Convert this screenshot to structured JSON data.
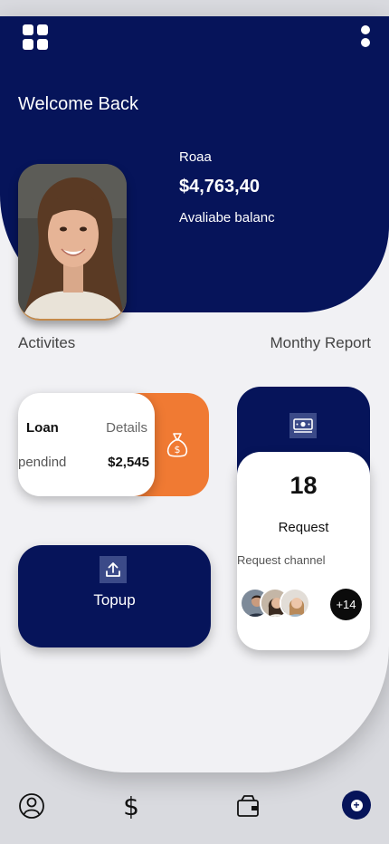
{
  "header": {
    "welcome": "Welcome Back",
    "user_name": "Roaa",
    "balance": "$4,763,40",
    "balance_label": "Avaliabe balanc"
  },
  "sections": {
    "activities": "Activites",
    "monthly_report": "Monthy Report"
  },
  "loan_card": {
    "title": "Loan",
    "details": "Details",
    "status": "pendind",
    "amount": "$2,545"
  },
  "topup_card": {
    "label": "Topup"
  },
  "request_card": {
    "count": "18",
    "label": "Request",
    "channel": "Request channel",
    "more": "+14"
  },
  "icons": {
    "menu": "grid-icon",
    "more": "vertical-dots-icon",
    "money_bag": "money-bag-icon",
    "upload": "upload-icon",
    "cash": "cash-icon",
    "nav_profile": "user-icon",
    "nav_dollar": "dollar-icon",
    "nav_wallet": "wallet-icon",
    "nav_add": "add-icon"
  },
  "nav": {
    "dollar_glyph": "$"
  },
  "colors": {
    "primary_navy": "#06145a",
    "accent_orange": "#f07a33",
    "surface": "#f1f1f4"
  }
}
